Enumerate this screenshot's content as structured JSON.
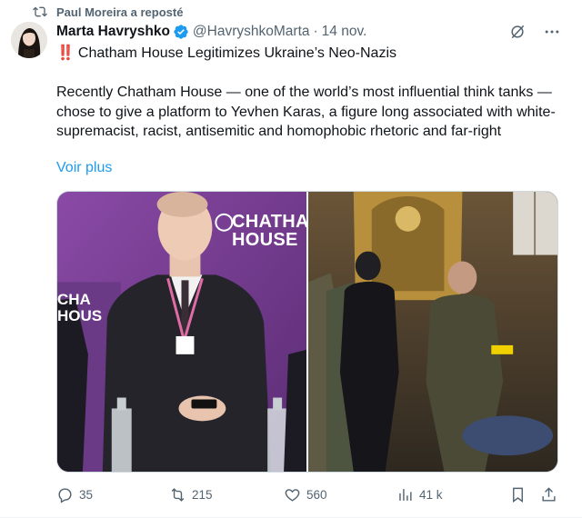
{
  "repost": {
    "label": "Paul Moreira a reposté",
    "icon": "repost-icon"
  },
  "author": {
    "display_name": "Marta Havryshko",
    "handle": "@HavryshkoMarta",
    "separator": "·",
    "date": "14 nov."
  },
  "tweet": {
    "title_emoji": "‼️",
    "title": "Chatham House Legitimizes Ukraine’s Neo-Nazis",
    "body": "Recently Chatham House — one of the world’s most influential think tanks — chose to give a platform to Yevhen Karas, a figure long associated with white-supremacist, racist, antisemitic and homophobic rhetoric and far-right",
    "see_more": "Voir plus"
  },
  "media": {
    "left_logo_line1": "CHATHAM",
    "left_logo_line2": "HOUSE",
    "left_logo_partial_1": "CHA",
    "left_logo_partial_2": "HOUS"
  },
  "actions": {
    "replies": "35",
    "reposts": "215",
    "likes": "560",
    "views": "41 k"
  },
  "colors": {
    "accent": "#1d9bf0",
    "muted": "#536471",
    "verified": "#1d9bf0",
    "alert": "#d0021b"
  }
}
